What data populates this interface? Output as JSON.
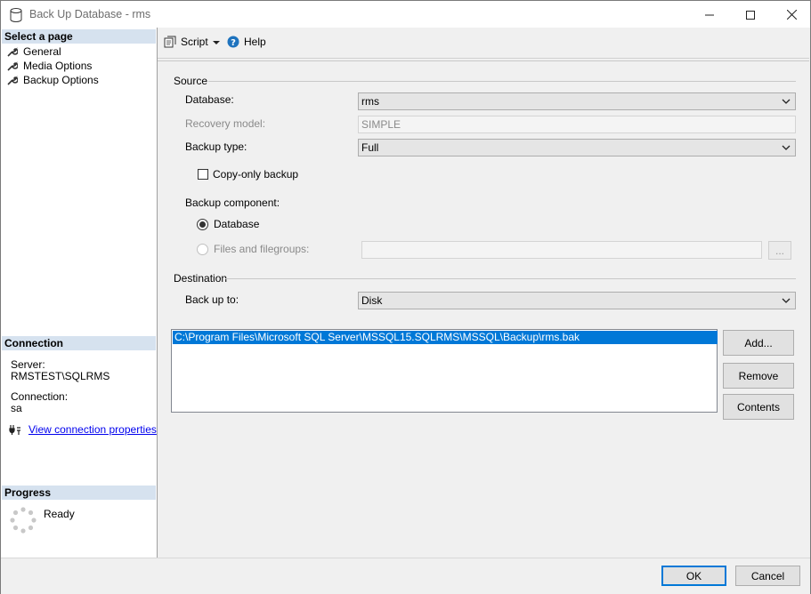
{
  "window": {
    "title": "Back Up Database - rms",
    "icon": "database-icon",
    "controls": [
      "minimize-icon",
      "maximize-icon",
      "close-icon"
    ]
  },
  "left_pane": {
    "select_page_header": "Select a page",
    "pages": [
      {
        "label": "General",
        "icon": "wrench-icon"
      },
      {
        "label": "Media Options",
        "icon": "wrench-icon"
      },
      {
        "label": "Backup Options",
        "icon": "wrench-icon"
      }
    ],
    "connection_header": "Connection",
    "server_label": "Server:",
    "server_value": "RMSTEST\\SQLRMS",
    "connection_label": "Connection:",
    "connection_value": "sa",
    "view_connection_link": "View connection properties",
    "progress_header": "Progress",
    "progress_status": "Ready"
  },
  "toolbar": {
    "script_label": "Script",
    "help_label": "Help"
  },
  "source": {
    "group_label": "Source",
    "database_label": "Database:",
    "database_value": "rms",
    "recovery_label": "Recovery model:",
    "recovery_value": "SIMPLE",
    "backup_type_label": "Backup type:",
    "backup_type_value": "Full",
    "copy_only_label": "Copy-only backup",
    "copy_only_checked": false,
    "component_label": "Backup component:",
    "component_database_label": "Database",
    "component_files_label": "Files and filegroups:",
    "files_browse_label": "..."
  },
  "destination": {
    "group_label": "Destination",
    "backup_to_label": "Back up to:",
    "backup_to_value": "Disk",
    "paths": [
      "C:\\Program Files\\Microsoft SQL Server\\MSSQL15.SQLRMS\\MSSQL\\Backup\\rms.bak"
    ],
    "add_label": "Add...",
    "remove_label": "Remove",
    "contents_label": "Contents"
  },
  "footer": {
    "ok_label": "OK",
    "cancel_label": "Cancel"
  },
  "colors": {
    "selection": "#0078d7",
    "section_header": "#d6e2ef",
    "link": "#0000ee"
  }
}
